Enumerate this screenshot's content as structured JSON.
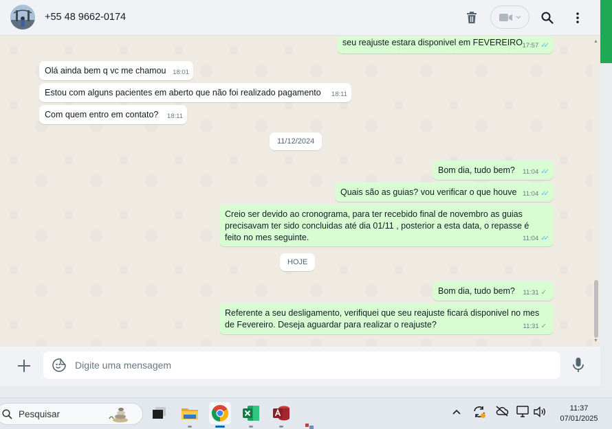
{
  "header": {
    "contact_name": "+55 48 9662-0174"
  },
  "messages": [
    {
      "direction": "out",
      "text": "seu reajuste estara disponivel em FEVEREIRO",
      "time": "17:57",
      "status": "read"
    },
    {
      "direction": "in",
      "text": "Olá ainda bem q vc me chamou",
      "time": "18:01"
    },
    {
      "direction": "in",
      "text": "Estou com alguns pacientes em aberto que não foi realizado pagamento",
      "time": "18:11"
    },
    {
      "direction": "in",
      "text": "Com quem entro em contato?",
      "time": "18:11"
    },
    {
      "direction": "out",
      "text": "Bom dia, tudo bem?",
      "time": "11:04",
      "status": "read"
    },
    {
      "direction": "out",
      "text": "Quais são as guias? vou verificar o que houve",
      "time": "11:04",
      "status": "read"
    },
    {
      "direction": "out",
      "text": "Creio ser devido ao cronograma, para ter recebido final de novembro as guias precisavam ter sido concluidas até dia 01/11 , posterior a esta data, o repasse é feito no mes seguinte.",
      "time": "11:04",
      "status": "read"
    },
    {
      "direction": "out",
      "text": "Bom dia, tudo bem?",
      "time": "11:31",
      "status": "sent"
    },
    {
      "direction": "out",
      "text": "Referente a seu desligamento, verifiquei que seu reajuste ficará disponivel no mes de Fevereiro. Deseja aguardar para realizar o reajuste?",
      "time": "11:31",
      "status": "sent"
    }
  ],
  "date_separators": [
    "11/12/2024",
    "HOJE"
  ],
  "composer": {
    "placeholder": "Digite uma mensagem"
  },
  "taskbar": {
    "search_label": "Pesquisar",
    "time": "11:37",
    "date": "07/01/2025",
    "apps": [
      "task-view",
      "file-explorer",
      "chrome",
      "excel",
      "access"
    ]
  },
  "colors": {
    "outgoing_bubble": "#d9fdd3",
    "incoming_bubble": "#ffffff",
    "read_tick": "#53bdeb",
    "accent_green": "#1fa855"
  }
}
